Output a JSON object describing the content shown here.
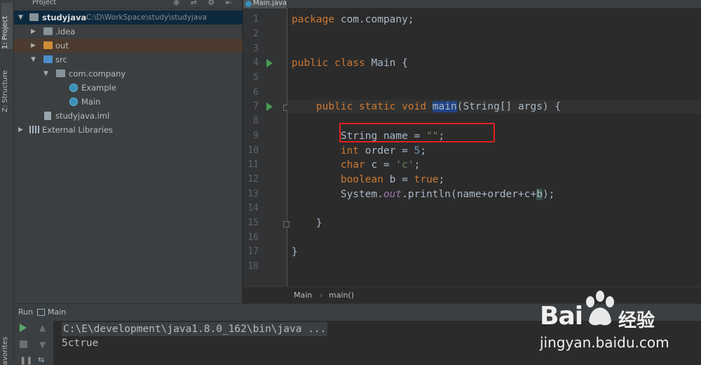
{
  "left_strip": {
    "project_tab": "1: Project",
    "structure_tab": "Z: Structure",
    "favorites_tab": "avorites"
  },
  "project_panel": {
    "title": "Project",
    "tree": [
      {
        "label": "studyjava",
        "hint": "C:\\D\\WorkSpace\\study\\studyjava",
        "icon": "folder-icon",
        "expanded": true
      },
      {
        "label": ".idea",
        "icon": "folder-icon",
        "expanded": false
      },
      {
        "label": "out",
        "icon": "folder-icon",
        "expanded": false
      },
      {
        "label": "src",
        "icon": "source-folder-icon",
        "expanded": true
      },
      {
        "label": "com.company",
        "icon": "package-icon",
        "expanded": true
      },
      {
        "label": "Example",
        "icon": "java-class-icon"
      },
      {
        "label": "Main",
        "icon": "java-class-icon"
      },
      {
        "label": "studyjava.iml",
        "icon": "module-file-icon"
      },
      {
        "label": "External Libraries",
        "icon": "library-icon",
        "expanded": false
      }
    ]
  },
  "editor": {
    "tab_label": "Main.java",
    "line_numbers": [
      "1",
      "2",
      "3",
      "4",
      "5",
      "6",
      "7",
      "8",
      "9",
      "10",
      "11",
      "12",
      "13",
      "14",
      "15",
      "16",
      "17",
      "18"
    ],
    "breadcrumb": {
      "class": "Main",
      "sep": "›",
      "method": "main()"
    }
  },
  "run_panel": {
    "label": "Run",
    "config_name": "Main",
    "command": "C:\\E\\development\\java1.8.0_162\\bin\\java ...",
    "output": "5ctrue"
  },
  "watermark": {
    "brand": "Bai",
    "brand_suffix": "经验",
    "url": "jingyan.baidu.com"
  },
  "colors": {
    "keyword": "#cc7832",
    "number": "#6897bb",
    "string": "#6a8759",
    "field": "#9876aa",
    "annotation_box": "#e02020"
  }
}
